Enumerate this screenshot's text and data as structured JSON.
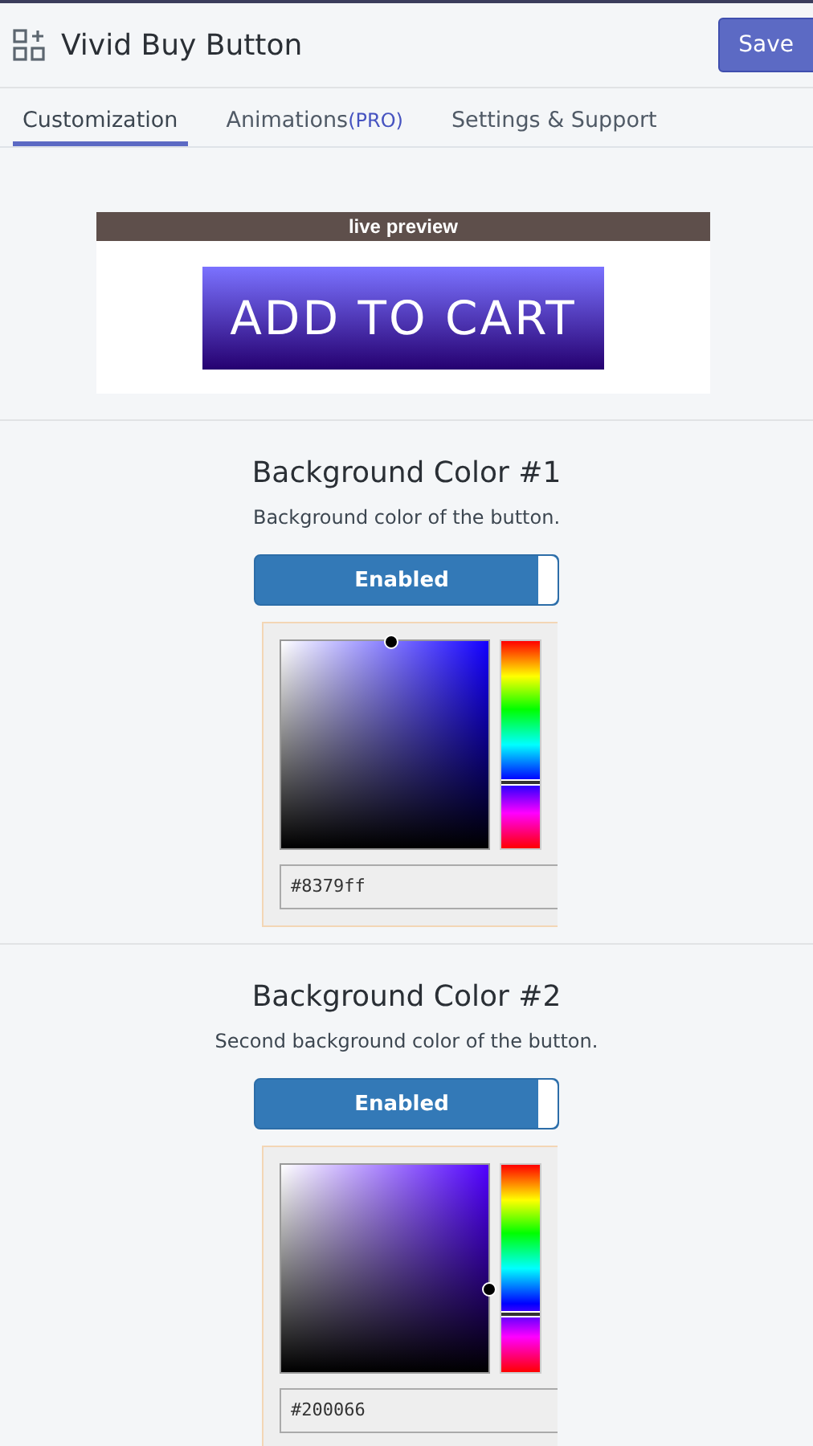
{
  "app": {
    "title": "Vivid Buy Button",
    "save_label": "Save"
  },
  "tabs": [
    {
      "label": "Customization",
      "selected": true
    },
    {
      "label": "Animations",
      "badge": "(PRO)",
      "selected": false
    },
    {
      "label": "Settings & Support",
      "selected": false
    }
  ],
  "preview": {
    "heading": "live preview",
    "button_label": "ADD TO CART"
  },
  "sections": [
    {
      "title": "Background Color #1",
      "description": "Background color of the button.",
      "toggle": {
        "label": "Enabled",
        "on": true
      },
      "color_value": "#8379ff"
    },
    {
      "title": "Background Color #2",
      "description": "Second background color of the button.",
      "toggle": {
        "label": "Enabled",
        "on": true
      },
      "color_value": "#200066"
    }
  ]
}
